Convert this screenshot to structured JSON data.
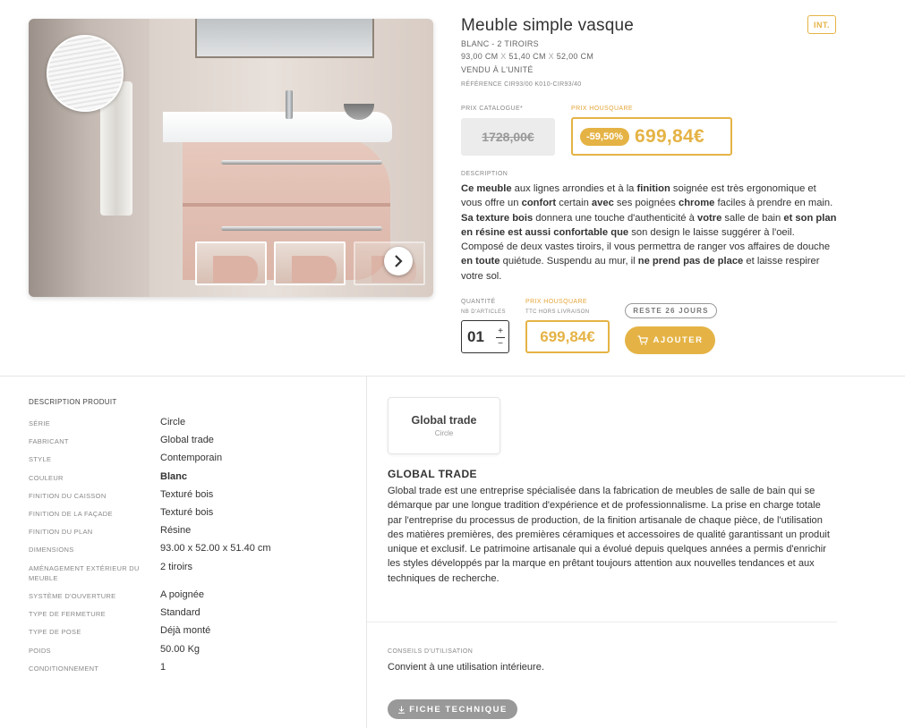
{
  "product": {
    "title": "Meuble simple vasque",
    "badge": "INT.",
    "color_drawers": "BLANC - 2 TIROIRS",
    "dim_1": "93,00 CM",
    "dim_sep": "X",
    "dim_2": "51,40 CM",
    "dim_3": "52,00 CM",
    "sold": "VENDU À L'UNITÉ",
    "reference": "RÉFÉRENCE CIR93/00 K010-CIR93/40"
  },
  "pricing": {
    "catalogue_label": "PRIX CATALOGUE*",
    "housquare_label": "PRIX HOUSQUARE",
    "old_price": "1728,00€",
    "discount": "-59,50%",
    "price": "699,84€"
  },
  "description": {
    "label": "DESCRIPTION"
  },
  "order": {
    "qty_label": "QUANTITÉ",
    "qty_sub": "NB D'ARTICLES",
    "qty_value": "01",
    "qty_plus": "+",
    "qty_minus": "−",
    "price_label": "PRIX HOUSQUARE",
    "price_sub": "TTC HORS LIVRAISON",
    "price": "699,84€",
    "days_left": "RESTE 26 JOURS",
    "add_label": "AJOUTER"
  },
  "specs": {
    "title": "DESCRIPTION PRODUIT",
    "rows": [
      {
        "k": "SÉRIE",
        "v": "Circle"
      },
      {
        "k": "FABRICANT",
        "v": "Global trade"
      },
      {
        "k": "STYLE",
        "v": "Contemporain"
      },
      {
        "k": "COULEUR",
        "v": "Blanc"
      },
      {
        "k": "FINITION DU CAISSON",
        "v": "Texturé bois"
      },
      {
        "k": "FINITION DE LA FAÇADE",
        "v": "Texturé bois"
      },
      {
        "k": "FINITION DU PLAN",
        "v": "Résine"
      },
      {
        "k": "DIMENSIONS",
        "v": "93.00 x 52.00 x 51.40 cm"
      },
      {
        "k": "AMÉNAGEMENT EXTÉRIEUR DU MEUBLE",
        "v": "2 tiroirs"
      },
      {
        "k": "SYSTÈME D'OUVERTURE",
        "v": "A poignée"
      },
      {
        "k": "TYPE DE FERMETURE",
        "v": "Standard"
      },
      {
        "k": "TYPE DE POSE",
        "v": "Déjà monté"
      },
      {
        "k": "POIDS",
        "v": "50.00 Kg"
      },
      {
        "k": "CONDITIONNEMENT",
        "v": "1"
      }
    ]
  },
  "brand": {
    "name": "Global trade",
    "series": "Circle",
    "heading": "GLOBAL TRADE",
    "text": "Global trade est une entreprise spécialisée dans la fabrication de meubles de salle de bain qui se démarque par une longue tradition d'expérience et de professionnalisme. La prise en charge totale par l'entreprise du processus de production, de la finition artisanale de chaque pièce, de l'utilisation des matières premières, des premières céramiques et accessoires de qualité garantissant un produit unique et exclusif. Le patrimoine artisanale qui a évolué depuis quelques années a permis d'enrichir les styles développés par la marque en prêtant toujours attention aux nouvelles tendances et aux techniques de recherche."
  },
  "usage": {
    "label": "CONSEILS D'UTILISATION",
    "text": "Convient à une utilisation intérieure.",
    "fiche_label": "FICHE TECHNIQUE"
  },
  "icons": {
    "next": "chevron-right-icon",
    "cart": "cart-icon",
    "download": "download-icon"
  },
  "colors": {
    "accent": "#e5b345",
    "muted": "#999999"
  }
}
